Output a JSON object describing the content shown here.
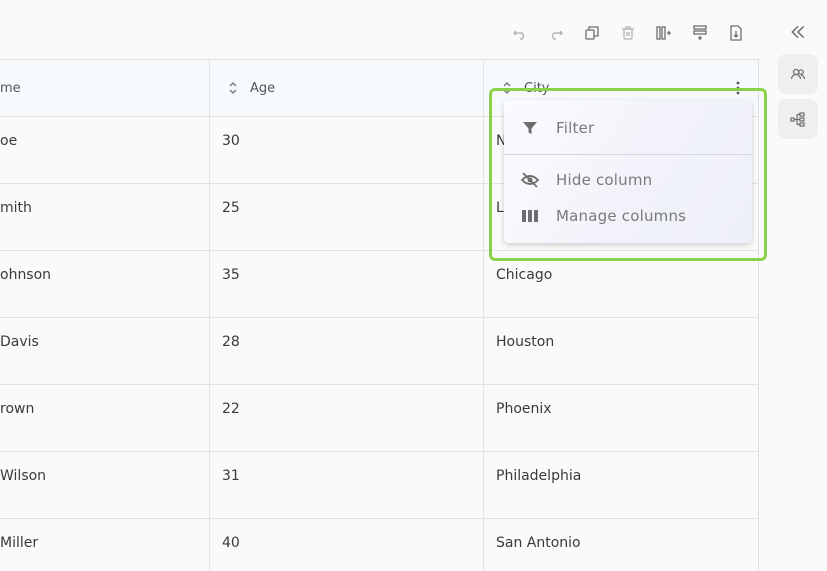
{
  "toolbar": {
    "buttons": [
      "undo-icon",
      "redo-icon",
      "copy-icon",
      "delete-icon",
      "add-column-icon",
      "add-row-icon",
      "export-icon"
    ]
  },
  "right_rail": {
    "icons": [
      "collapse-panel-icon",
      "users-icon",
      "hierarchy-icon"
    ]
  },
  "columns": [
    {
      "label": "me"
    },
    {
      "label": "Age"
    },
    {
      "label": "City"
    }
  ],
  "rows": [
    {
      "name": "oe",
      "age": "30",
      "city": "N"
    },
    {
      "name": "mith",
      "age": "25",
      "city": "L"
    },
    {
      "name": "ohnson",
      "age": "35",
      "city": "Chicago"
    },
    {
      "name": "Davis",
      "age": "28",
      "city": "Houston"
    },
    {
      "name": "rown",
      "age": "22",
      "city": "Phoenix"
    },
    {
      "name": " Wilson",
      "age": "31",
      "city": "Philadelphia"
    },
    {
      "name": "Miller",
      "age": "40",
      "city": "San Antonio"
    }
  ],
  "column_menu": {
    "items": [
      {
        "label": "Filter",
        "icon": "filter-icon"
      },
      {
        "label": "Hide column",
        "icon": "eye-off-icon"
      },
      {
        "label": "Manage columns",
        "icon": "columns-icon"
      }
    ]
  },
  "colors": {
    "highlight": "#8bd14a",
    "header_bg": "#f6fafd",
    "icon_gray": "#8a8a8a"
  }
}
